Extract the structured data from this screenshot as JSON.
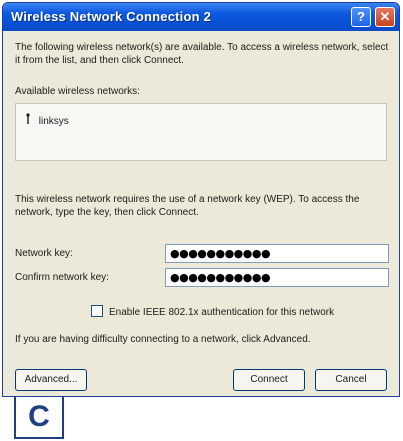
{
  "window": {
    "title": "Wireless Network Connection 2"
  },
  "titlebar_buttons": {
    "help": "?",
    "close": "✕"
  },
  "intro_text": "The following wireless network(s) are available. To access a wireless network, select it from the list, and then click Connect.",
  "available_label": "Available wireless networks:",
  "networks": [
    {
      "name": "linksys",
      "icon": "network-antenna-icon"
    }
  ],
  "wep_text": "This wireless network requires the use of a network key (WEP). To access the network, type the key, then click Connect.",
  "network_key": {
    "label": "Network key:",
    "value": "●●●●●●●●●●●"
  },
  "confirm_key": {
    "label": "Confirm network key:",
    "value": "●●●●●●●●●●●"
  },
  "ieee_checkbox": {
    "label": "Enable IEEE 802.1x authentication for this network",
    "checked": false
  },
  "advanced_text": "If you are having difficulty connecting to a network, click Advanced.",
  "buttons": {
    "advanced": "Advanced...",
    "connect": "Connect",
    "cancel": "Cancel"
  },
  "step_label": "C"
}
